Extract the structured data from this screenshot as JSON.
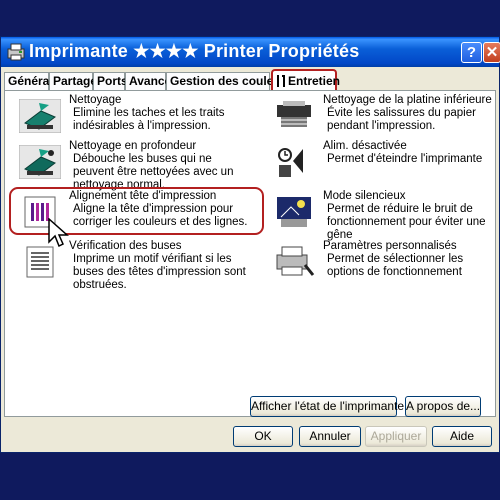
{
  "window": {
    "title": "Imprimante   ★★★★   Printer   Propriétés",
    "help_label": "?",
    "close_label": "✕"
  },
  "tabs": [
    {
      "label": "Général"
    },
    {
      "label": "Partage"
    },
    {
      "label": "Ports"
    },
    {
      "label": "Avancé"
    },
    {
      "label": "Gestion des couleurs"
    },
    {
      "label": "Entretien"
    }
  ],
  "left_items": [
    {
      "icon": "ink-cartridge-cleaning-icon",
      "title": "Nettoyage",
      "desc": "Elimine les taches et les traits indésirables à l'impression."
    },
    {
      "icon": "deep-cleaning-icon",
      "title": "Nettoyage en profondeur",
      "desc": "Débouche les buses qui ne peuvent être nettoyées avec un nettoyage normal."
    },
    {
      "icon": "print-head-alignment-icon",
      "title": "Alignement tête d'impression",
      "desc": "Aligne la tête d'impression pour corriger les couleurs et des lignes."
    },
    {
      "icon": "nozzle-check-icon",
      "title": "Vérification des buses",
      "desc": "Imprime un motif vérifiant si les buses des têtes d'impression sont obstruées."
    }
  ],
  "right_items": [
    {
      "icon": "bottom-plate-cleaning-icon",
      "title": "Nettoyage de la platine inférieure",
      "desc": "Évite les salissures du papier pendant l'impression."
    },
    {
      "icon": "auto-power-off-icon",
      "title": "Alim. désactivée",
      "desc": "Permet d'éteindre l'imprimante"
    },
    {
      "icon": "quiet-mode-icon",
      "title": "Mode silencieux",
      "desc": "Permet de réduire le bruit de fonctionnement pour éviter une gêne"
    },
    {
      "icon": "custom-settings-icon",
      "title": "Paramètres personnalisés",
      "desc": "Permet de sélectionner les options de fonctionnement"
    }
  ],
  "panel_buttons": {
    "status": "Afficher l'état de l'imprimante...",
    "about": "A propos de..."
  },
  "dialog_buttons": {
    "ok": "OK",
    "cancel": "Annuler",
    "apply": "Appliquer",
    "help": "Aide"
  }
}
